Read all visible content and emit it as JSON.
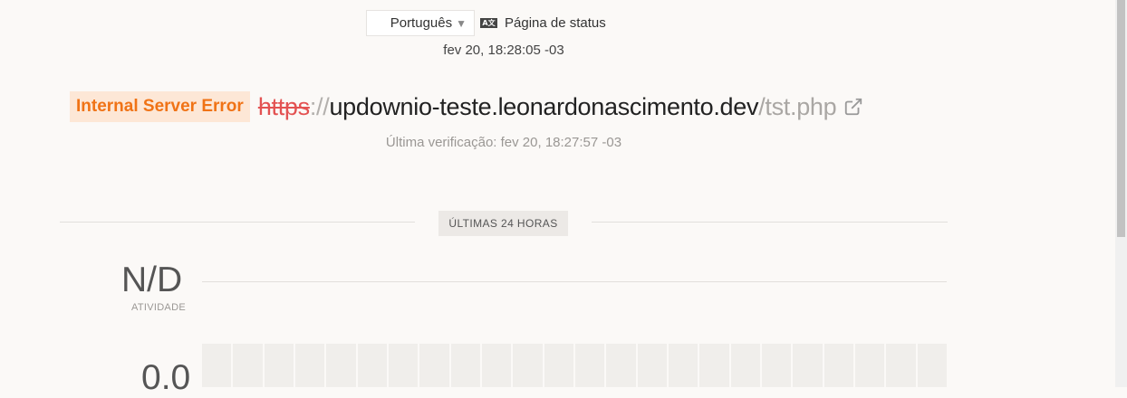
{
  "header": {
    "language": "Português",
    "status_icon_text": "A ☑",
    "status_page_label": "Página de status",
    "current_time": "fev 20, 18:28:05 -03"
  },
  "monitor": {
    "status_badge": "Internal Server Error",
    "url": {
      "scheme": "https",
      "separator": "://",
      "host": "updownio-teste.leonardonascimento.dev",
      "path": "/tst.php"
    },
    "last_check": "Última verificação: fev 20, 18:27:57 -03"
  },
  "period": {
    "label": "ÚLTIMAS 24 HORAS"
  },
  "activity": {
    "value": "N/D",
    "label": "ATIVIDADE"
  },
  "response": {
    "value": "0.0"
  },
  "colors": {
    "error_text": "#f07316",
    "error_bg": "#fde7d6",
    "scheme_red": "#e35252"
  },
  "icons": {
    "external_link": "external-link-icon",
    "language": "language-icon"
  }
}
